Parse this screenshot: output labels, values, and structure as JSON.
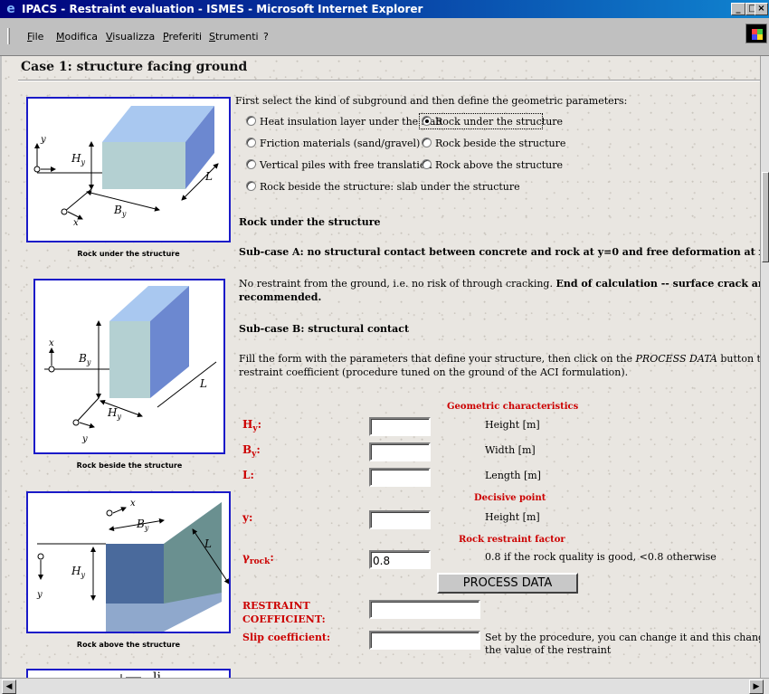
{
  "window": {
    "title": "IPACS - Restraint evaluation - ISMES - Microsoft Internet Explorer",
    "minimize": "_",
    "maximize": "□",
    "close": "×"
  },
  "menu": [
    "File",
    "Modifica",
    "Visualizza",
    "Preferiti",
    "Strumenti",
    "?"
  ],
  "page": {
    "title": "Case 1: structure facing ground",
    "intro": "First select the kind of subground and then define the geometric parameters:"
  },
  "figures": [
    {
      "caption": "Rock under the structure",
      "labels": {
        "h": "H",
        "h_sub": "y",
        "b": "B",
        "b_sub": "y",
        "l": "L",
        "y": "y",
        "x": "x"
      }
    },
    {
      "caption": "Rock beside the structure",
      "labels": {
        "h": "H",
        "h_sub": "y",
        "b": "B",
        "b_sub": "y",
        "l": "L",
        "y": "y",
        "x": "x"
      }
    },
    {
      "caption": "Rock above the structure",
      "labels": {
        "h": "H",
        "h_sub": "y",
        "b": "B",
        "b_sub": "y",
        "l": "L",
        "y": "y",
        "x": "x"
      }
    },
    {
      "label_partial": "li"
    }
  ],
  "options": [
    {
      "label": "Heat insulation layer under the slab",
      "selected": false
    },
    {
      "label": "Rock under the structure",
      "selected": true
    },
    {
      "label": "Friction materials (sand/gravel)",
      "selected": false
    },
    {
      "label": "Rock beside the structure",
      "selected": false
    },
    {
      "label": "Vertical piles with free translation",
      "selected": false
    },
    {
      "label": "Rock above the structure",
      "selected": false
    },
    {
      "label": "Rock beside the structure: slab under the structure",
      "selected": false
    }
  ],
  "section": {
    "heading": "Rock under the structure",
    "subcase_a": "Sub-case A: no structural contact between concrete and rock at y=0 and free deformation at x=0",
    "no_restraint": "No restraint from the ground, i.e. no risk of through cracking.",
    "end_calc_1": "End of calculation -- surface crack analysis is",
    "end_calc_2": "recommended.",
    "subcase_b": "Sub-case B: structural contact",
    "fill_1a": "Fill the form with the parameters that define your structure, then click on the",
    "fill_1b": "PROCESS DATA",
    "fill_1c": "button to evaluate the",
    "fill_2": "restraint coefficient (procedure tuned on the ground of the ACI formulation)."
  },
  "form": {
    "geo_heading": "Geometric characteristics",
    "hy_label": "H",
    "hy_sub": "y",
    "hy_unit": "Height [m]",
    "hy_value": "",
    "by_label": "B",
    "by_sub": "y",
    "by_unit": "Width [m]",
    "by_value": "",
    "l_label": "L:",
    "l_unit": "Length [m]",
    "l_value": "",
    "decisive_heading": "Decisive point",
    "y_label": "y:",
    "y_unit": "Height [m]",
    "y_value": "",
    "rock_heading": "Rock restraint factor",
    "gamma_label": "γ",
    "gamma_sub": "rock",
    "gamma_value": "0.8",
    "gamma_note": "0.8 if the rock quality is good, <0.8 otherwise",
    "process_button": "PROCESS DATA",
    "restraint_label_1": "RESTRAINT",
    "restraint_label_2": "COEFFICIENT:",
    "restraint_value": "",
    "slip_label": "Slip coefficient:",
    "slip_value": "",
    "slip_note_1": "Set by the procedure, you can change it and this change will affe",
    "slip_note_2": "the value of the restraint"
  }
}
